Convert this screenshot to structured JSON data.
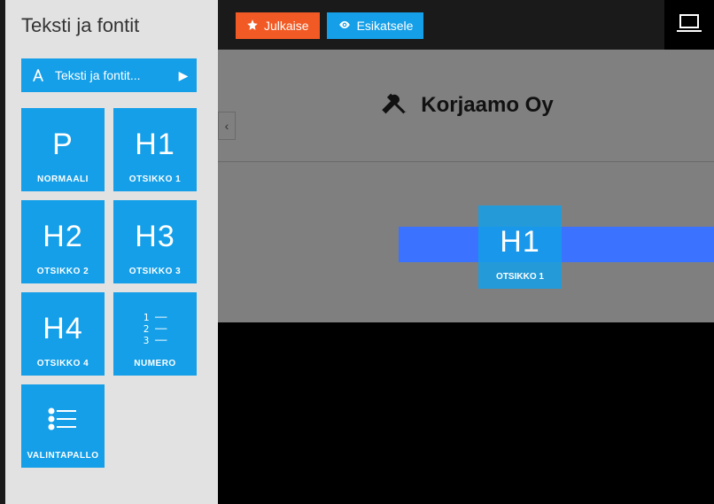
{
  "topbar": {
    "publish_label": "Julkaise",
    "preview_label": "Esikatsele"
  },
  "sidebar": {
    "title": "Teksti ja fontit",
    "dropdown_label": "Teksti ja fontit...",
    "tiles": [
      {
        "glyph": "P",
        "caption": "NORMAALI"
      },
      {
        "glyph": "H1",
        "caption": "OTSIKKO 1"
      },
      {
        "glyph": "H2",
        "caption": "OTSIKKO 2"
      },
      {
        "glyph": "H3",
        "caption": "OTSIKKO 3"
      },
      {
        "glyph": "H4",
        "caption": "OTSIKKO 4"
      },
      {
        "glyph": "numlist",
        "caption": "NUMERO"
      },
      {
        "glyph": "bulletlist",
        "caption": "VALINTAPALLO"
      }
    ]
  },
  "canvas": {
    "site_title": "Korjaamo Oy",
    "drag_preview": {
      "glyph": "H1",
      "caption": "OTSIKKO 1"
    }
  }
}
